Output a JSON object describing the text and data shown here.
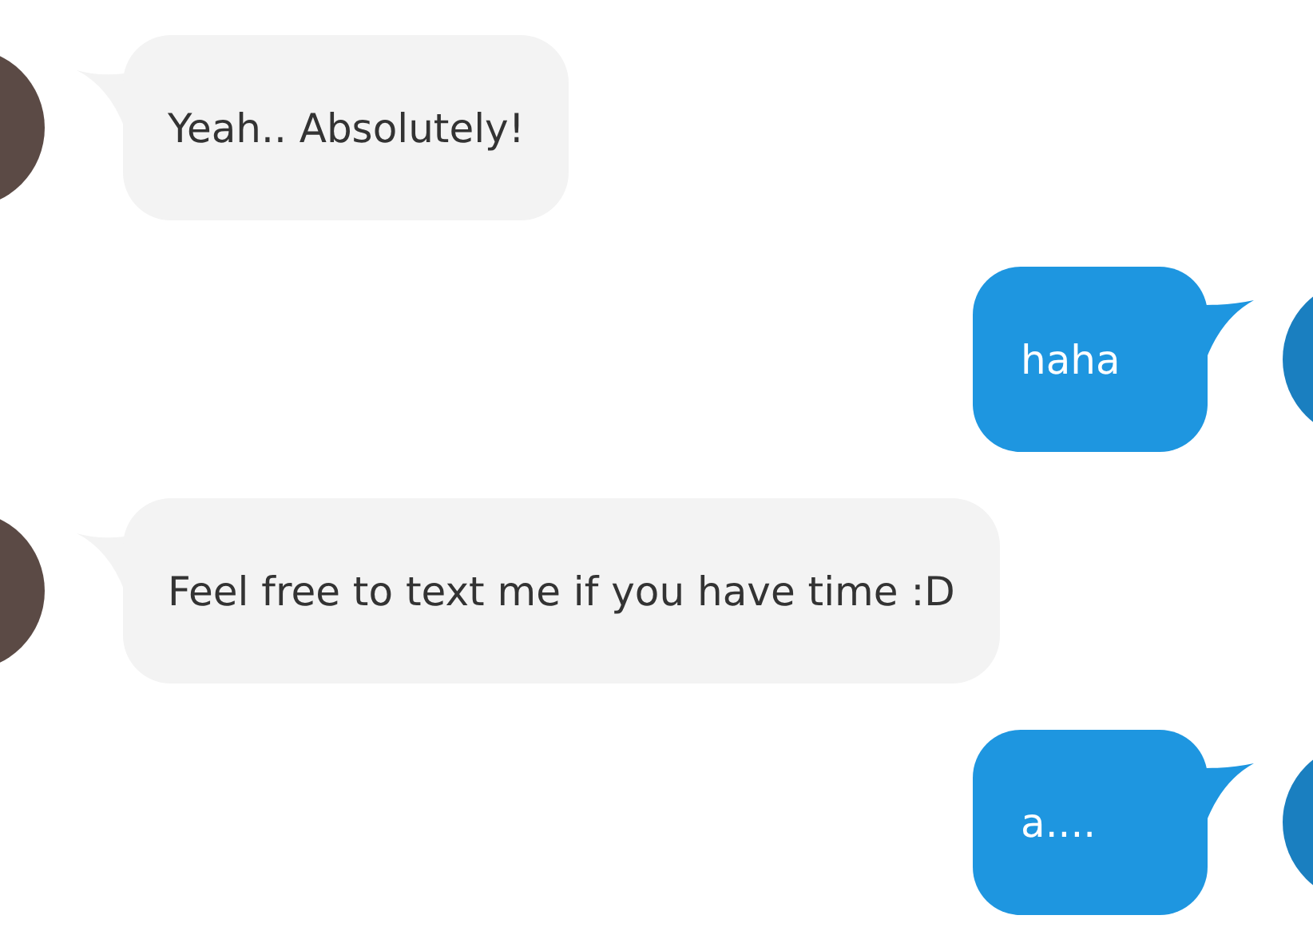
{
  "messages": [
    {
      "kind": "incoming",
      "text": "Yeah.. Absolutely!"
    },
    {
      "kind": "outgoing",
      "text": "haha"
    },
    {
      "kind": "incoming",
      "text": "Feel free to text me if you have time :D"
    },
    {
      "kind": "outgoing",
      "text": "a...."
    }
  ]
}
